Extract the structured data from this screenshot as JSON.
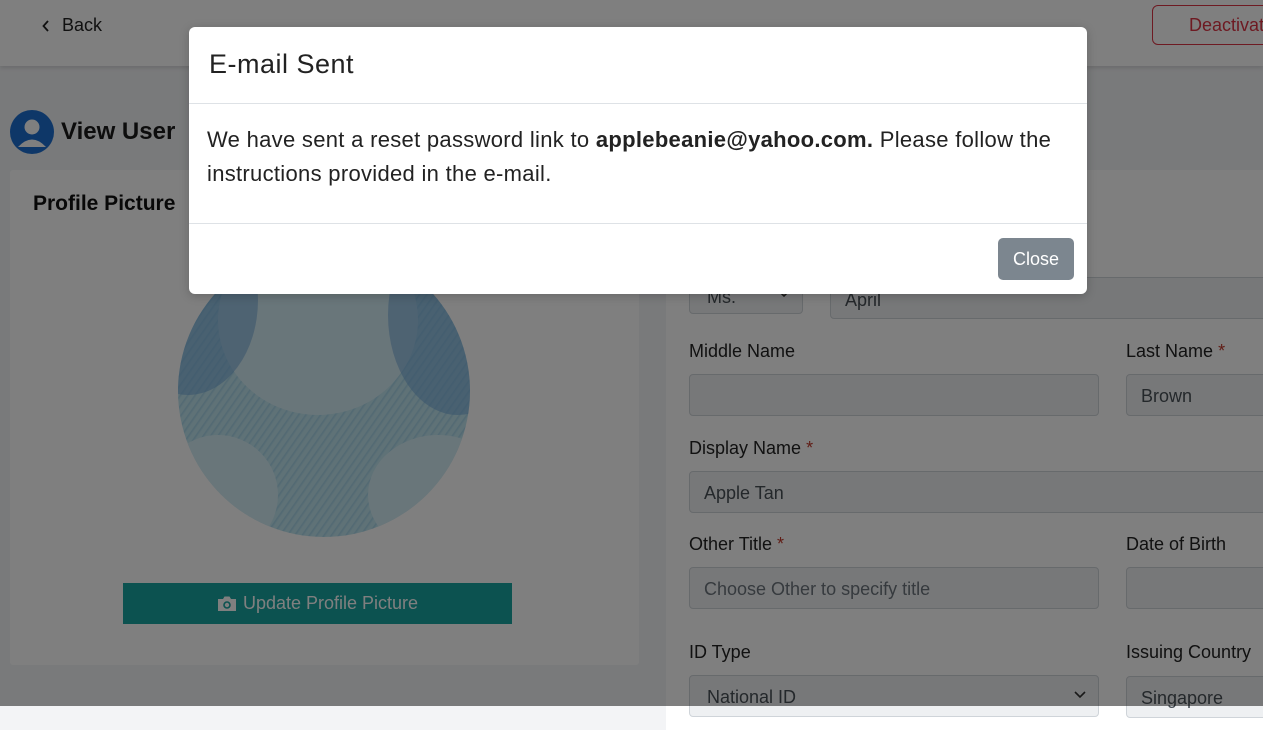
{
  "topbar": {
    "back_label": "Back",
    "deactivate_label": "Deactivate"
  },
  "page": {
    "title": "View User"
  },
  "profile": {
    "heading": "Profile Picture",
    "update_button_label": "Update Profile Picture"
  },
  "form": {
    "salutation_value": "Ms.",
    "first_name_value": "April",
    "middle_name_label": "Middle Name",
    "middle_name_value": "",
    "last_name_label": "Last Name",
    "last_name_value": "Brown",
    "display_name_label": "Display Name",
    "display_name_value": "Apple Tan",
    "other_title_label": "Other Title",
    "other_title_placeholder": "Choose Other to specify title",
    "dob_label": "Date of Birth",
    "dob_value": "",
    "id_type_label": "ID Type",
    "id_type_value": "National ID",
    "issuing_country_label": "Issuing Country",
    "issuing_country_value": "Singapore",
    "required_mark": "*"
  },
  "modal": {
    "title": "E-mail Sent",
    "body_prefix": "We have sent a reset password link to ",
    "body_email": "applebeanie@yahoo.com.",
    "body_suffix": " Please follow the instructions provided in the e-mail.",
    "close_label": "Close"
  },
  "colors": {
    "accent_teal": "#18a5a0",
    "danger": "#dc3545",
    "avatar_blue": "#1c6fd1",
    "close_button": "#7c868f"
  }
}
